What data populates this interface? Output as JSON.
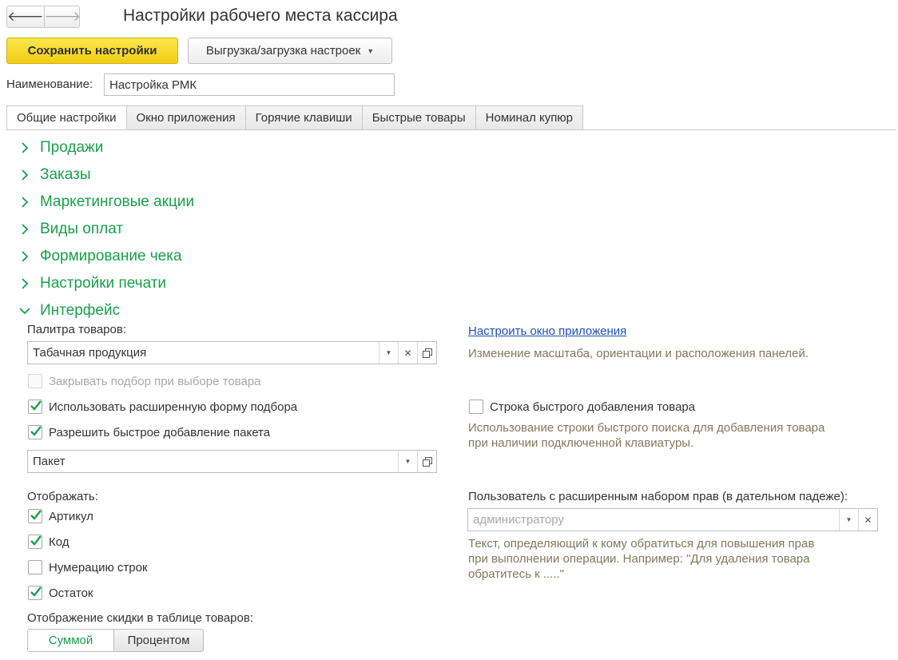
{
  "window": {
    "title": "Настройки рабочего места кассира"
  },
  "nav": {
    "back_icon": "arrow-left-icon",
    "forward_icon": "arrow-right-icon"
  },
  "toolbar": {
    "save_label": "Сохранить настройки",
    "export_label": "Выгрузка/загрузка настроек"
  },
  "name_field": {
    "label": "Наименование:",
    "value": "Настройка РМК"
  },
  "tabs": [
    {
      "label": "Общие настройки",
      "active": true
    },
    {
      "label": "Окно приложения",
      "active": false
    },
    {
      "label": "Горячие клавиши",
      "active": false
    },
    {
      "label": "Быстрые товары",
      "active": false
    },
    {
      "label": "Номинал купюр",
      "active": false
    }
  ],
  "groups": [
    {
      "label": "Продажи",
      "expanded": false
    },
    {
      "label": "Заказы",
      "expanded": false
    },
    {
      "label": "Маркетинговые акции",
      "expanded": false
    },
    {
      "label": "Виды оплат",
      "expanded": false
    },
    {
      "label": "Формирование чека",
      "expanded": false
    },
    {
      "label": "Настройки печати",
      "expanded": false
    },
    {
      "label": "Интерфейс",
      "expanded": true
    }
  ],
  "interface": {
    "palette": {
      "label": "Палитра товаров:",
      "value": "Табачная продукция"
    },
    "close_selection": {
      "label": "Закрывать подбор при выборе товара",
      "checked": false,
      "disabled": true
    },
    "extended_form": {
      "label": "Использовать расширенную форму подбора",
      "checked": true
    },
    "quick_package": {
      "label": "Разрешить быстрое добавление пакета",
      "checked": true
    },
    "package_field": {
      "value": "Пакет"
    },
    "display": {
      "label": "Отображать:",
      "items": [
        {
          "label": "Артикул",
          "checked": true
        },
        {
          "label": "Код",
          "checked": true
        },
        {
          "label": "Нумерацию строк",
          "checked": false
        },
        {
          "label": "Остаток",
          "checked": true
        }
      ]
    },
    "discount_display": {
      "label": "Отображение скидки в таблице товаров:",
      "options": [
        "Суммой",
        "Процентом"
      ],
      "selected": "Суммой"
    },
    "app_window_link": {
      "label": "Настроить окно приложения",
      "description": "Изменение масштаба, ориентации и расположения панелей."
    },
    "quick_add_row": {
      "label": "Строка быстрого добавления товара",
      "checked": false,
      "description_lines": [
        "Использование строки быстрого поиска для добавления товара",
        "при наличии подключенной клавиатуры."
      ]
    },
    "privileged_user": {
      "label": "Пользователь с расширенным набором прав (в дательном падеже):",
      "placeholder": "администратору",
      "description_lines": [
        "Текст, определяющий к кому обратиться для повышения прав",
        "при выполнении операции. Например: \"Для удаления товара",
        "обратитесь к .....\""
      ]
    }
  },
  "colors": {
    "accent_green": "#19a04b",
    "primary_button": "#f5d924",
    "link_blue": "#1f4fb5",
    "description_text": "#7e7b5c"
  }
}
